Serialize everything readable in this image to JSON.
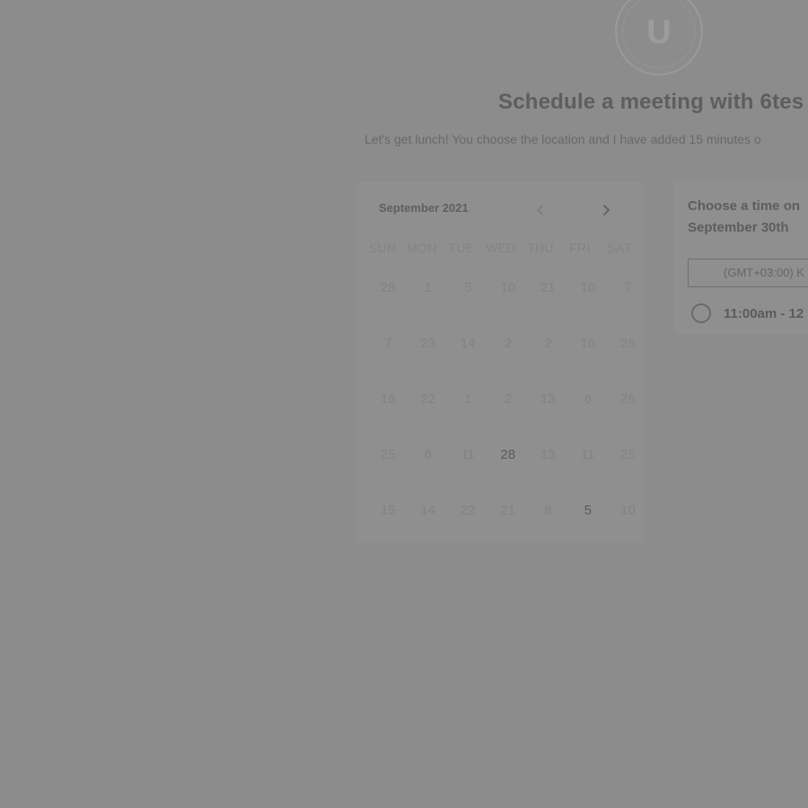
{
  "header": {
    "avatar_letter": "U",
    "title": "Schedule a meeting with 6tes",
    "description": "Let's get lunch! You choose the location and I have added 15 minutes o"
  },
  "calendar": {
    "month_label": "September 2021",
    "prev_icon": "chevron-left-icon",
    "next_icon": "chevron-right-icon",
    "weekdays": [
      "SUN",
      "MON",
      "TUE",
      "WED",
      "THU",
      "FRI",
      "SAT"
    ],
    "weeks": [
      [
        "28",
        "1",
        "5",
        "10",
        "21",
        "10",
        "7"
      ],
      [
        "7",
        "23",
        "14",
        "2",
        "2",
        "16",
        "26"
      ],
      [
        "16",
        "22",
        "1",
        "2",
        "13",
        "6",
        "26"
      ],
      [
        "25",
        "6",
        "11",
        "28",
        "13",
        "11",
        "25"
      ],
      [
        "15",
        "14",
        "22",
        "21",
        "8",
        "5",
        "10"
      ]
    ]
  },
  "time_panel": {
    "heading_line1": "Choose a time on",
    "heading_line2": "September 30th",
    "timezone": "(GMT+03:00) K",
    "slot_label": "11:00am - 12"
  }
}
